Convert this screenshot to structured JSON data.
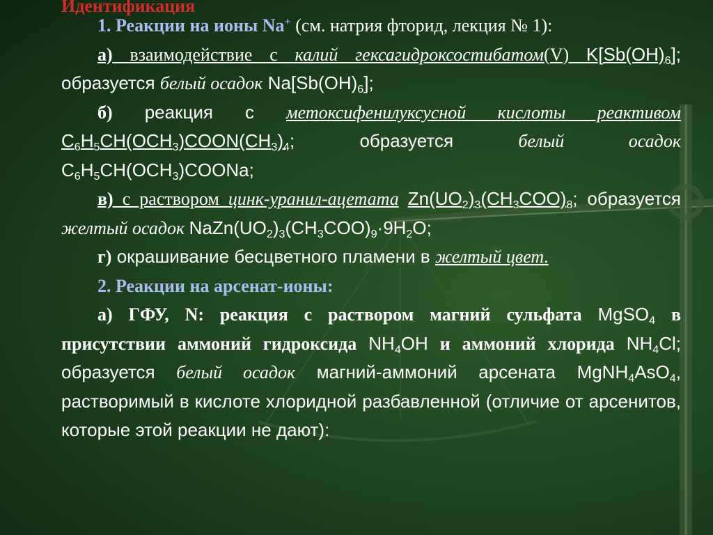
{
  "heading": "Идентификация",
  "section1": {
    "title": "1. Реакции на ионы Na",
    "title_sup": "+",
    "note": " (см. натрия фторид, лекция № 1):"
  },
  "item_a": {
    "marker": "а)",
    "t1": " взаимодействие с ",
    "reagent": "калий гексагидроксостибатом",
    "t2": "(V) ",
    "f1": "K[Sb(OH)",
    "f1_sub": "6",
    "f1_end": "];",
    "t3": " образуется ",
    "precip": "белый осадок",
    "f2": "  Na[Sb(OH)",
    "f2_sub": "6",
    "f2_end": "];"
  },
  "item_b": {
    "marker": "б)",
    "t1": " реакция с ",
    "reagent": "метоксифенилуксусной кислоты реактивом",
    "f_c": "C",
    "f_6": "6",
    "f_h": "H",
    "f_5": "5",
    "f_mid": "CH(OCH",
    "f_3": "3",
    "f_mid2": ")COON(CH",
    "f_3b": "3",
    "f_close": ")",
    "f_4": "4",
    "t2": "; образуется ",
    "precip": "белый осадок",
    "p_c": "C",
    "p_6": "6",
    "p_h": "H",
    "p_5": "5",
    "p_mid": "CH(OCH",
    "p_3": "3",
    "p_end": ")COONa;"
  },
  "item_v": {
    "marker": "в)",
    "t1": " с раствором ",
    "reagent": "цинк-уранил-ацетата",
    "f_a": "Zn(UO",
    "f_2": "2",
    "f_b": ")",
    "f_3": "3",
    "f_c": "(CH",
    "f_3b": "3",
    "f_d": "COO)",
    "f_8": "8",
    "f_e": ";",
    "t2": " образуется ",
    "precip": "желтый осадок",
    "p_a": "NaZn(UO",
    "p_2": "2",
    "p_b": ")",
    "p_3": "3",
    "p_c": "(CH",
    "p_3b": "3",
    "p_d": "COO)",
    "p_9": "9",
    "p_e": "·9H",
    "p_2b": "2",
    "p_f": "O;"
  },
  "item_g": {
    "marker": "г)",
    "t1": " окрашивание бесцветного пламени в ",
    "color": "желтый цвет",
    "end": "."
  },
  "section2": {
    "title": "2. Реакции на арсенат-ионы:"
  },
  "item_a2": {
    "marker": "а) ГФУ, N: реакция с раствором магний сульфата",
    "f1a": "MgSO",
    "f1_sub": "4",
    "t2": " в присутствии аммоний гидроксида",
    "f2a": "NH",
    "f2_sub": "4",
    "f2b": "OH",
    "t3": " и аммоний хлорида",
    "f3a": "NH",
    "f3_sub": "4",
    "f3b": "Cl",
    "t4": "; образуется ",
    "precip": "белый осадок",
    "t5": " магний-аммоний арсената ",
    "p_a": "MgNH",
    "p_sub": "4",
    "p_b": "AsO",
    "p_sub2": "4",
    "t6": ", растворимый в кислоте хлоридной разбавленной (отличие от арсенитов, которые этой реакции не дают):"
  }
}
